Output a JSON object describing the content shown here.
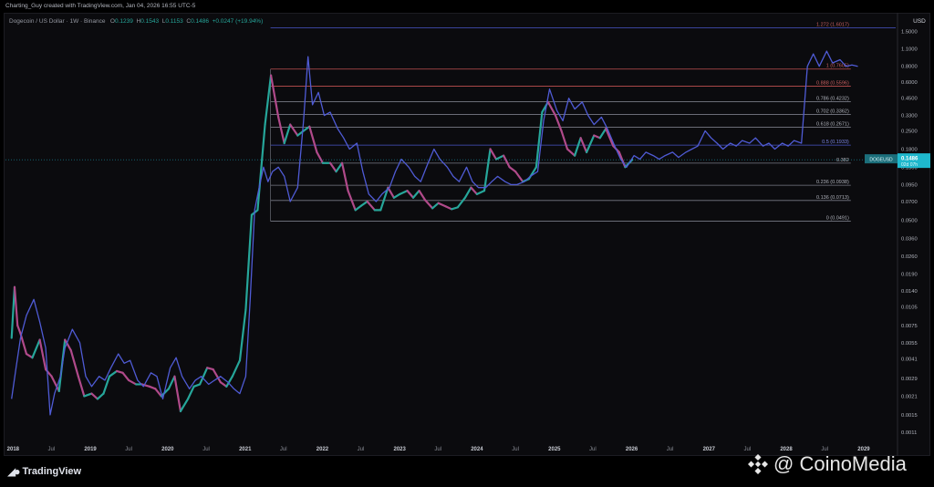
{
  "header": {
    "attribution": "Charting_Guy created with TradingView.com, Jan 04, 2026 16:55 UTC-5"
  },
  "legend": {
    "symbol": "Dogecoin / US Dollar · 1W · Binance",
    "open_label": "O",
    "open": "0.1239",
    "high_label": "H",
    "high": "0.1543",
    "low_label": "L",
    "low": "0.1153",
    "close_label": "C",
    "close": "0.1486",
    "change": "+0.0247 (+19.94%)"
  },
  "footer": {
    "logo_text": "TradingView",
    "watermark": "@ CoinoMedia"
  },
  "colors": {
    "background": "#000000",
    "price_line": "#4f5bd5",
    "candle_up": "#26a69a",
    "candle_down": "#b04a8a",
    "fib_line": "#787b86",
    "fib_top": "#c05050",
    "price_tag": "#1fb8cd"
  },
  "chart_data": {
    "type": "line",
    "title": "Dogecoin / US Dollar · 1W · Binance",
    "currency_label": "USD",
    "y_scale": "log",
    "ylim": [
      0.0009,
      1.9
    ],
    "x_tick_labels": [
      "2018",
      "Jul",
      "2019",
      "Jul",
      "2020",
      "Jul",
      "2021",
      "Jul",
      "2022",
      "Jul",
      "2023",
      "Jul",
      "2024",
      "Jul",
      "2025",
      "Jul",
      "2026",
      "Jul",
      "2027",
      "Jul",
      "2028",
      "Jul",
      "2029"
    ],
    "x_ticks": [
      "2018-01-01",
      "2018-07-01",
      "2019-01-01",
      "2019-07-01",
      "2020-01-01",
      "2020-07-01",
      "2021-01-01",
      "2021-07-01",
      "2022-01-01",
      "2022-07-01",
      "2023-01-01",
      "2023-07-01",
      "2024-01-01",
      "2024-07-01",
      "2025-01-01",
      "2025-07-01",
      "2026-01-01",
      "2026-07-01",
      "2027-01-01",
      "2027-07-01",
      "2028-01-01",
      "2028-07-01",
      "2029-01-01"
    ],
    "y_tick_labels": [
      "1.5000",
      "1.1000",
      "0.8000",
      "0.6000",
      "0.4500",
      "0.3300",
      "0.2500",
      "0.1800",
      "0.1300",
      "0.0950",
      "0.0700",
      "0.0500",
      "0.0360",
      "0.0260",
      "0.0190",
      "0.0140",
      "0.0105",
      "0.0075",
      "0.0055",
      "0.0041",
      "0.0029",
      "0.0021",
      "0.0015",
      "0.0011"
    ],
    "y_ticks": [
      1.5,
      1.1,
      0.8,
      0.6,
      0.45,
      0.33,
      0.25,
      0.18,
      0.13,
      0.095,
      0.07,
      0.05,
      0.036,
      0.026,
      0.019,
      0.014,
      0.0105,
      0.0075,
      0.0055,
      0.0041,
      0.0029,
      0.0021,
      0.0015,
      0.0011
    ],
    "fib_levels": [
      {
        "label": "1.272 (1.6017)",
        "value": 1.6017
      },
      {
        "label": "1 (0.7605)",
        "value": 0.7605
      },
      {
        "label": "0.888 (0.5596)",
        "value": 0.5596
      },
      {
        "label": "0.786 (0.4232)",
        "value": 0.4232
      },
      {
        "label": "0.702 (0.3362)",
        "value": 0.3362
      },
      {
        "label": "0.618 (0.2671)",
        "value": 0.2671
      },
      {
        "label": "0.5 (0.1933)",
        "value": 0.1933
      },
      {
        "label": "0.382",
        "value": 0.1398
      },
      {
        "label": "0.236 (0.0938)",
        "value": 0.0938
      },
      {
        "label": "0.136 (0.0713)",
        "value": 0.0713
      },
      {
        "label": "0 (0.0491)",
        "value": 0.0491
      }
    ],
    "fib_start": "2021-05-01",
    "fib_end": "2028-11-01",
    "current_price": {
      "label": "0.1486",
      "value": 0.1486,
      "sublabel": "DOGEUSD",
      "countdown": "02d 07h"
    },
    "series": [
      {
        "kind": "candles",
        "points": [
          [
            "2017-12-25",
            0.006
          ],
          [
            "2018-01-08",
            0.015
          ],
          [
            "2018-01-22",
            0.0075
          ],
          [
            "2018-02-05",
            0.0065
          ],
          [
            "2018-03-05",
            0.0045
          ],
          [
            "2018-04-02",
            0.0042
          ],
          [
            "2018-05-07",
            0.0058
          ],
          [
            "2018-06-04",
            0.0034
          ],
          [
            "2018-07-02",
            0.003
          ],
          [
            "2018-08-06",
            0.0023
          ],
          [
            "2018-09-03",
            0.0058
          ],
          [
            "2018-10-01",
            0.0048
          ],
          [
            "2018-11-05",
            0.003
          ],
          [
            "2018-12-03",
            0.0021
          ],
          [
            "2019-01-07",
            0.0022
          ],
          [
            "2019-02-04",
            0.002
          ],
          [
            "2019-03-04",
            0.0022
          ],
          [
            "2019-04-01",
            0.003
          ],
          [
            "2019-05-06",
            0.0033
          ],
          [
            "2019-06-03",
            0.0032
          ],
          [
            "2019-07-01",
            0.0028
          ],
          [
            "2019-08-05",
            0.0026
          ],
          [
            "2019-09-02",
            0.0026
          ],
          [
            "2019-10-07",
            0.0025
          ],
          [
            "2019-11-04",
            0.0024
          ],
          [
            "2019-12-02",
            0.0021
          ],
          [
            "2020-01-06",
            0.0024
          ],
          [
            "2020-02-03",
            0.003
          ],
          [
            "2020-03-02",
            0.0016
          ],
          [
            "2020-04-06",
            0.002
          ],
          [
            "2020-05-04",
            0.0025
          ],
          [
            "2020-06-01",
            0.0026
          ],
          [
            "2020-07-06",
            0.0035
          ],
          [
            "2020-08-03",
            0.0034
          ],
          [
            "2020-09-07",
            0.0027
          ],
          [
            "2020-10-05",
            0.0025
          ],
          [
            "2020-11-02",
            0.003
          ],
          [
            "2020-12-07",
            0.004
          ],
          [
            "2021-01-04",
            0.01
          ],
          [
            "2021-02-01",
            0.055
          ],
          [
            "2021-03-01",
            0.06
          ],
          [
            "2021-04-05",
            0.28
          ],
          [
            "2021-05-03",
            0.68
          ],
          [
            "2021-06-07",
            0.32
          ],
          [
            "2021-07-05",
            0.2
          ],
          [
            "2021-08-02",
            0.28
          ],
          [
            "2021-09-06",
            0.23
          ],
          [
            "2021-10-04",
            0.25
          ],
          [
            "2021-11-01",
            0.27
          ],
          [
            "2021-12-06",
            0.17
          ],
          [
            "2022-01-03",
            0.14
          ],
          [
            "2022-02-07",
            0.14
          ],
          [
            "2022-03-07",
            0.12
          ],
          [
            "2022-04-04",
            0.14
          ],
          [
            "2022-05-02",
            0.085
          ],
          [
            "2022-06-06",
            0.06
          ],
          [
            "2022-07-04",
            0.065
          ],
          [
            "2022-08-01",
            0.07
          ],
          [
            "2022-09-05",
            0.06
          ],
          [
            "2022-10-03",
            0.06
          ],
          [
            "2022-11-07",
            0.09
          ],
          [
            "2022-12-05",
            0.075
          ],
          [
            "2023-01-02",
            0.08
          ],
          [
            "2023-02-06",
            0.085
          ],
          [
            "2023-03-06",
            0.075
          ],
          [
            "2023-04-03",
            0.085
          ],
          [
            "2023-05-01",
            0.072
          ],
          [
            "2023-06-05",
            0.062
          ],
          [
            "2023-07-03",
            0.068
          ],
          [
            "2023-08-07",
            0.064
          ],
          [
            "2023-09-04",
            0.061
          ],
          [
            "2023-10-02",
            0.063
          ],
          [
            "2023-11-06",
            0.075
          ],
          [
            "2023-12-04",
            0.09
          ],
          [
            "2024-01-01",
            0.08
          ],
          [
            "2024-02-05",
            0.085
          ],
          [
            "2024-03-04",
            0.18
          ],
          [
            "2024-04-01",
            0.15
          ],
          [
            "2024-05-06",
            0.16
          ],
          [
            "2024-06-03",
            0.13
          ],
          [
            "2024-07-01",
            0.12
          ],
          [
            "2024-08-05",
            0.1
          ],
          [
            "2024-09-02",
            0.105
          ],
          [
            "2024-10-07",
            0.13
          ],
          [
            "2024-11-04",
            0.35
          ],
          [
            "2024-12-02",
            0.42
          ],
          [
            "2025-01-06",
            0.33
          ],
          [
            "2025-02-03",
            0.25
          ],
          [
            "2025-03-03",
            0.18
          ],
          [
            "2025-04-07",
            0.16
          ],
          [
            "2025-05-05",
            0.22
          ],
          [
            "2025-06-02",
            0.17
          ],
          [
            "2025-07-07",
            0.23
          ],
          [
            "2025-08-04",
            0.22
          ],
          [
            "2025-09-01",
            0.26
          ],
          [
            "2025-10-06",
            0.19
          ],
          [
            "2025-11-03",
            0.17
          ],
          [
            "2025-12-01",
            0.13
          ],
          [
            "2026-01-04",
            0.1486
          ]
        ]
      },
      {
        "kind": "fractal_projection",
        "points": [
          [
            "2017-12-25",
            0.002
          ],
          [
            "2018-01-15",
            0.0035
          ],
          [
            "2018-02-05",
            0.006
          ],
          [
            "2018-03-05",
            0.009
          ],
          [
            "2018-04-09",
            0.012
          ],
          [
            "2018-05-07",
            0.008
          ],
          [
            "2018-06-04",
            0.005
          ],
          [
            "2018-06-25",
            0.0015
          ],
          [
            "2018-07-16",
            0.0022
          ],
          [
            "2018-08-13",
            0.003
          ],
          [
            "2018-09-03",
            0.005
          ],
          [
            "2018-10-08",
            0.007
          ],
          [
            "2018-11-12",
            0.0055
          ],
          [
            "2018-12-10",
            0.003
          ],
          [
            "2019-01-07",
            0.0025
          ],
          [
            "2019-02-11",
            0.003
          ],
          [
            "2019-03-11",
            0.0028
          ],
          [
            "2019-04-08",
            0.0035
          ],
          [
            "2019-05-13",
            0.0045
          ],
          [
            "2019-06-10",
            0.0038
          ],
          [
            "2019-07-08",
            0.004
          ],
          [
            "2019-08-12",
            0.0028
          ],
          [
            "2019-09-09",
            0.0025
          ],
          [
            "2019-10-14",
            0.0032
          ],
          [
            "2019-11-11",
            0.003
          ],
          [
            "2019-12-09",
            0.002
          ],
          [
            "2020-01-13",
            0.0035
          ],
          [
            "2020-02-10",
            0.0042
          ],
          [
            "2020-03-09",
            0.003
          ],
          [
            "2020-04-13",
            0.0024
          ],
          [
            "2020-05-11",
            0.0028
          ],
          [
            "2020-06-08",
            0.003
          ],
          [
            "2020-07-13",
            0.0026
          ],
          [
            "2020-08-10",
            0.0028
          ],
          [
            "2020-09-07",
            0.003
          ],
          [
            "2020-10-12",
            0.0027
          ],
          [
            "2020-11-09",
            0.0024
          ],
          [
            "2020-12-07",
            0.0022
          ],
          [
            "2021-01-04",
            0.003
          ],
          [
            "2021-01-25",
            0.012
          ],
          [
            "2021-02-15",
            0.06
          ],
          [
            "2021-03-08",
            0.09
          ],
          [
            "2021-03-29",
            0.13
          ],
          [
            "2021-04-19",
            0.1
          ],
          [
            "2021-05-10",
            0.12
          ],
          [
            "2021-06-07",
            0.13
          ],
          [
            "2021-07-05",
            0.11
          ],
          [
            "2021-08-02",
            0.07
          ],
          [
            "2021-09-06",
            0.09
          ],
          [
            "2021-10-04",
            0.3
          ],
          [
            "2021-10-25",
            0.95
          ],
          [
            "2021-11-15",
            0.4
          ],
          [
            "2021-12-13",
            0.5
          ],
          [
            "2022-01-10",
            0.33
          ],
          [
            "2022-02-07",
            0.35
          ],
          [
            "2022-03-14",
            0.26
          ],
          [
            "2022-04-11",
            0.22
          ],
          [
            "2022-05-09",
            0.18
          ],
          [
            "2022-06-13",
            0.2
          ],
          [
            "2022-07-11",
            0.12
          ],
          [
            "2022-08-08",
            0.08
          ],
          [
            "2022-09-12",
            0.07
          ],
          [
            "2022-10-10",
            0.08
          ],
          [
            "2022-11-14",
            0.09
          ],
          [
            "2022-12-12",
            0.12
          ],
          [
            "2023-01-09",
            0.15
          ],
          [
            "2023-02-13",
            0.13
          ],
          [
            "2023-03-13",
            0.11
          ],
          [
            "2023-04-10",
            0.1
          ],
          [
            "2023-05-15",
            0.14
          ],
          [
            "2023-06-12",
            0.18
          ],
          [
            "2023-07-10",
            0.15
          ],
          [
            "2023-08-14",
            0.13
          ],
          [
            "2023-09-11",
            0.11
          ],
          [
            "2023-10-09",
            0.1
          ],
          [
            "2023-11-13",
            0.13
          ],
          [
            "2023-12-11",
            0.1
          ],
          [
            "2024-01-08",
            0.09
          ],
          [
            "2024-02-12",
            0.09
          ],
          [
            "2024-03-11",
            0.1
          ],
          [
            "2024-04-08",
            0.11
          ],
          [
            "2024-05-13",
            0.1
          ],
          [
            "2024-06-10",
            0.095
          ],
          [
            "2024-07-08",
            0.095
          ],
          [
            "2024-08-12",
            0.1
          ],
          [
            "2024-09-09",
            0.11
          ],
          [
            "2024-10-14",
            0.12
          ],
          [
            "2024-11-11",
            0.3
          ],
          [
            "2024-12-09",
            0.53
          ],
          [
            "2025-01-13",
            0.36
          ],
          [
            "2025-02-10",
            0.3
          ],
          [
            "2025-03-10",
            0.45
          ],
          [
            "2025-04-07",
            0.37
          ],
          [
            "2025-05-12",
            0.42
          ],
          [
            "2025-06-09",
            0.33
          ],
          [
            "2025-07-07",
            0.28
          ],
          [
            "2025-08-11",
            0.32
          ],
          [
            "2025-09-08",
            0.26
          ],
          [
            "2025-10-13",
            0.19
          ],
          [
            "2025-11-10",
            0.15
          ],
          [
            "2025-12-08",
            0.13
          ],
          [
            "2026-01-12",
            0.16
          ],
          [
            "2026-02-09",
            0.15
          ],
          [
            "2026-03-09",
            0.17
          ],
          [
            "2026-04-13",
            0.16
          ],
          [
            "2026-05-11",
            0.15
          ],
          [
            "2026-06-08",
            0.16
          ],
          [
            "2026-07-13",
            0.17
          ],
          [
            "2026-08-10",
            0.155
          ],
          [
            "2026-09-14",
            0.17
          ],
          [
            "2026-10-12",
            0.18
          ],
          [
            "2026-11-09",
            0.19
          ],
          [
            "2026-12-14",
            0.25
          ],
          [
            "2027-01-11",
            0.22
          ],
          [
            "2027-02-08",
            0.2
          ],
          [
            "2027-03-08",
            0.18
          ],
          [
            "2027-04-12",
            0.2
          ],
          [
            "2027-05-10",
            0.19
          ],
          [
            "2027-06-07",
            0.21
          ],
          [
            "2027-07-12",
            0.2
          ],
          [
            "2027-08-09",
            0.22
          ],
          [
            "2027-09-13",
            0.19
          ],
          [
            "2027-10-11",
            0.2
          ],
          [
            "2027-11-08",
            0.18
          ],
          [
            "2027-12-13",
            0.2
          ],
          [
            "2028-01-10",
            0.19
          ],
          [
            "2028-02-07",
            0.21
          ],
          [
            "2028-03-13",
            0.2
          ],
          [
            "2028-04-10",
            0.8
          ],
          [
            "2028-05-08",
            1.0
          ],
          [
            "2028-06-05",
            0.8
          ],
          [
            "2028-07-10",
            1.05
          ],
          [
            "2028-08-07",
            0.85
          ],
          [
            "2028-09-11",
            0.9
          ],
          [
            "2028-10-09",
            0.8
          ],
          [
            "2028-11-06",
            0.82
          ],
          [
            "2028-12-04",
            0.8
          ]
        ]
      }
    ]
  }
}
